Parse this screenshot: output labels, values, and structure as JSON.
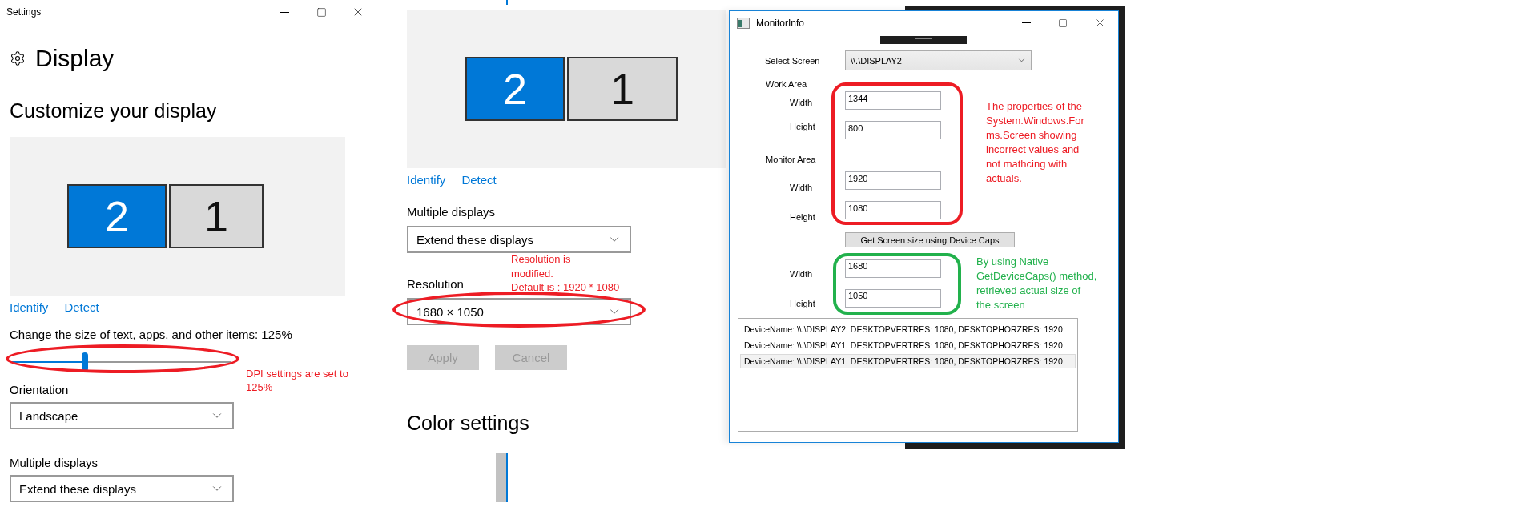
{
  "settings_window": {
    "title": "Settings",
    "heading": "Display",
    "section_title": "Customize your display",
    "monitors": [
      {
        "label": "2",
        "selected": true
      },
      {
        "label": "1",
        "selected": false
      }
    ],
    "links": [
      "Identify",
      "Detect"
    ],
    "scale": {
      "label": "Change the size of text, apps, and other items: 125%",
      "level": 0.34
    },
    "orientation": {
      "label": "Orientation",
      "value": "Landscape"
    },
    "multiple_displays": {
      "label": "Multiple displays",
      "value": "Extend these displays"
    }
  },
  "settings_scrolled": {
    "monitors": [
      {
        "label": "2",
        "selected": true
      },
      {
        "label": "1",
        "selected": false
      }
    ],
    "links": [
      "Identify",
      "Detect"
    ],
    "multiple_displays": {
      "label": "Multiple displays",
      "value": "Extend these displays"
    },
    "resolution": {
      "label": "Resolution",
      "value": "1680 × 1050"
    },
    "buttons": [
      {
        "label": "Apply",
        "disabled": true
      },
      {
        "label": "Cancel",
        "disabled": true
      }
    ],
    "section_title": "Color settings"
  },
  "monitor_info": {
    "title": "MonitorInfo",
    "select_screen": {
      "label": "Select Screen",
      "value": "\\\\.\\DISPLAY2"
    },
    "work_area": {
      "label": "Work Area",
      "fields": [
        {
          "label": "Width",
          "value": "1344"
        },
        {
          "label": "Height",
          "value": "800"
        }
      ]
    },
    "monitor_area": {
      "label": "Monitor Area",
      "fields": [
        {
          "label": "Width",
          "value": "1920"
        },
        {
          "label": "Height",
          "value": "1080"
        }
      ]
    },
    "button": "Get Screen size using Device Caps",
    "device_caps_fields": [
      {
        "label": "Width",
        "value": "1680"
      },
      {
        "label": "Height",
        "value": "1050"
      }
    ],
    "list": [
      {
        "text": "DeviceName: \\\\.\\DISPLAY2, DESKTOPVERTRES: 1080, DESKTOPHORZRES: 1920",
        "selected": false
      },
      {
        "text": "DeviceName: \\\\.\\DISPLAY1, DESKTOPVERTRES: 1080, DESKTOPHORZRES: 1920",
        "selected": false
      },
      {
        "text": "DeviceName: \\\\.\\DISPLAY1, DESKTOPVERTRES: 1080, DESKTOPHORZRES: 1920",
        "selected": true
      }
    ]
  },
  "annotations": [
    {
      "lines": [
        "DPI settings are set to",
        "125%"
      ],
      "color": "#ed1c24"
    },
    {
      "lines": [
        "Resolution is",
        "modified.",
        "Default is : 1920 * 1080"
      ],
      "color": "#ed1c24"
    },
    {
      "lines": [
        "The properties of the",
        "System.Windows.For",
        "ms.Screen showing",
        "incorrect values and",
        "not mathcing with",
        "actuals."
      ],
      "color": "#ed1c24"
    },
    {
      "lines": [
        "By using Native",
        "GetDeviceCaps() method,",
        "retrieved actual size of",
        "the screen"
      ],
      "color": "#22b14c"
    }
  ],
  "highlights": [
    {
      "kind": "ellipse",
      "color": "#ed1c24"
    },
    {
      "kind": "ellipse",
      "color": "#ed1c24"
    },
    {
      "kind": "rounded",
      "color": "#ed1c24"
    },
    {
      "kind": "rounded",
      "color": "#22b14c"
    }
  ]
}
